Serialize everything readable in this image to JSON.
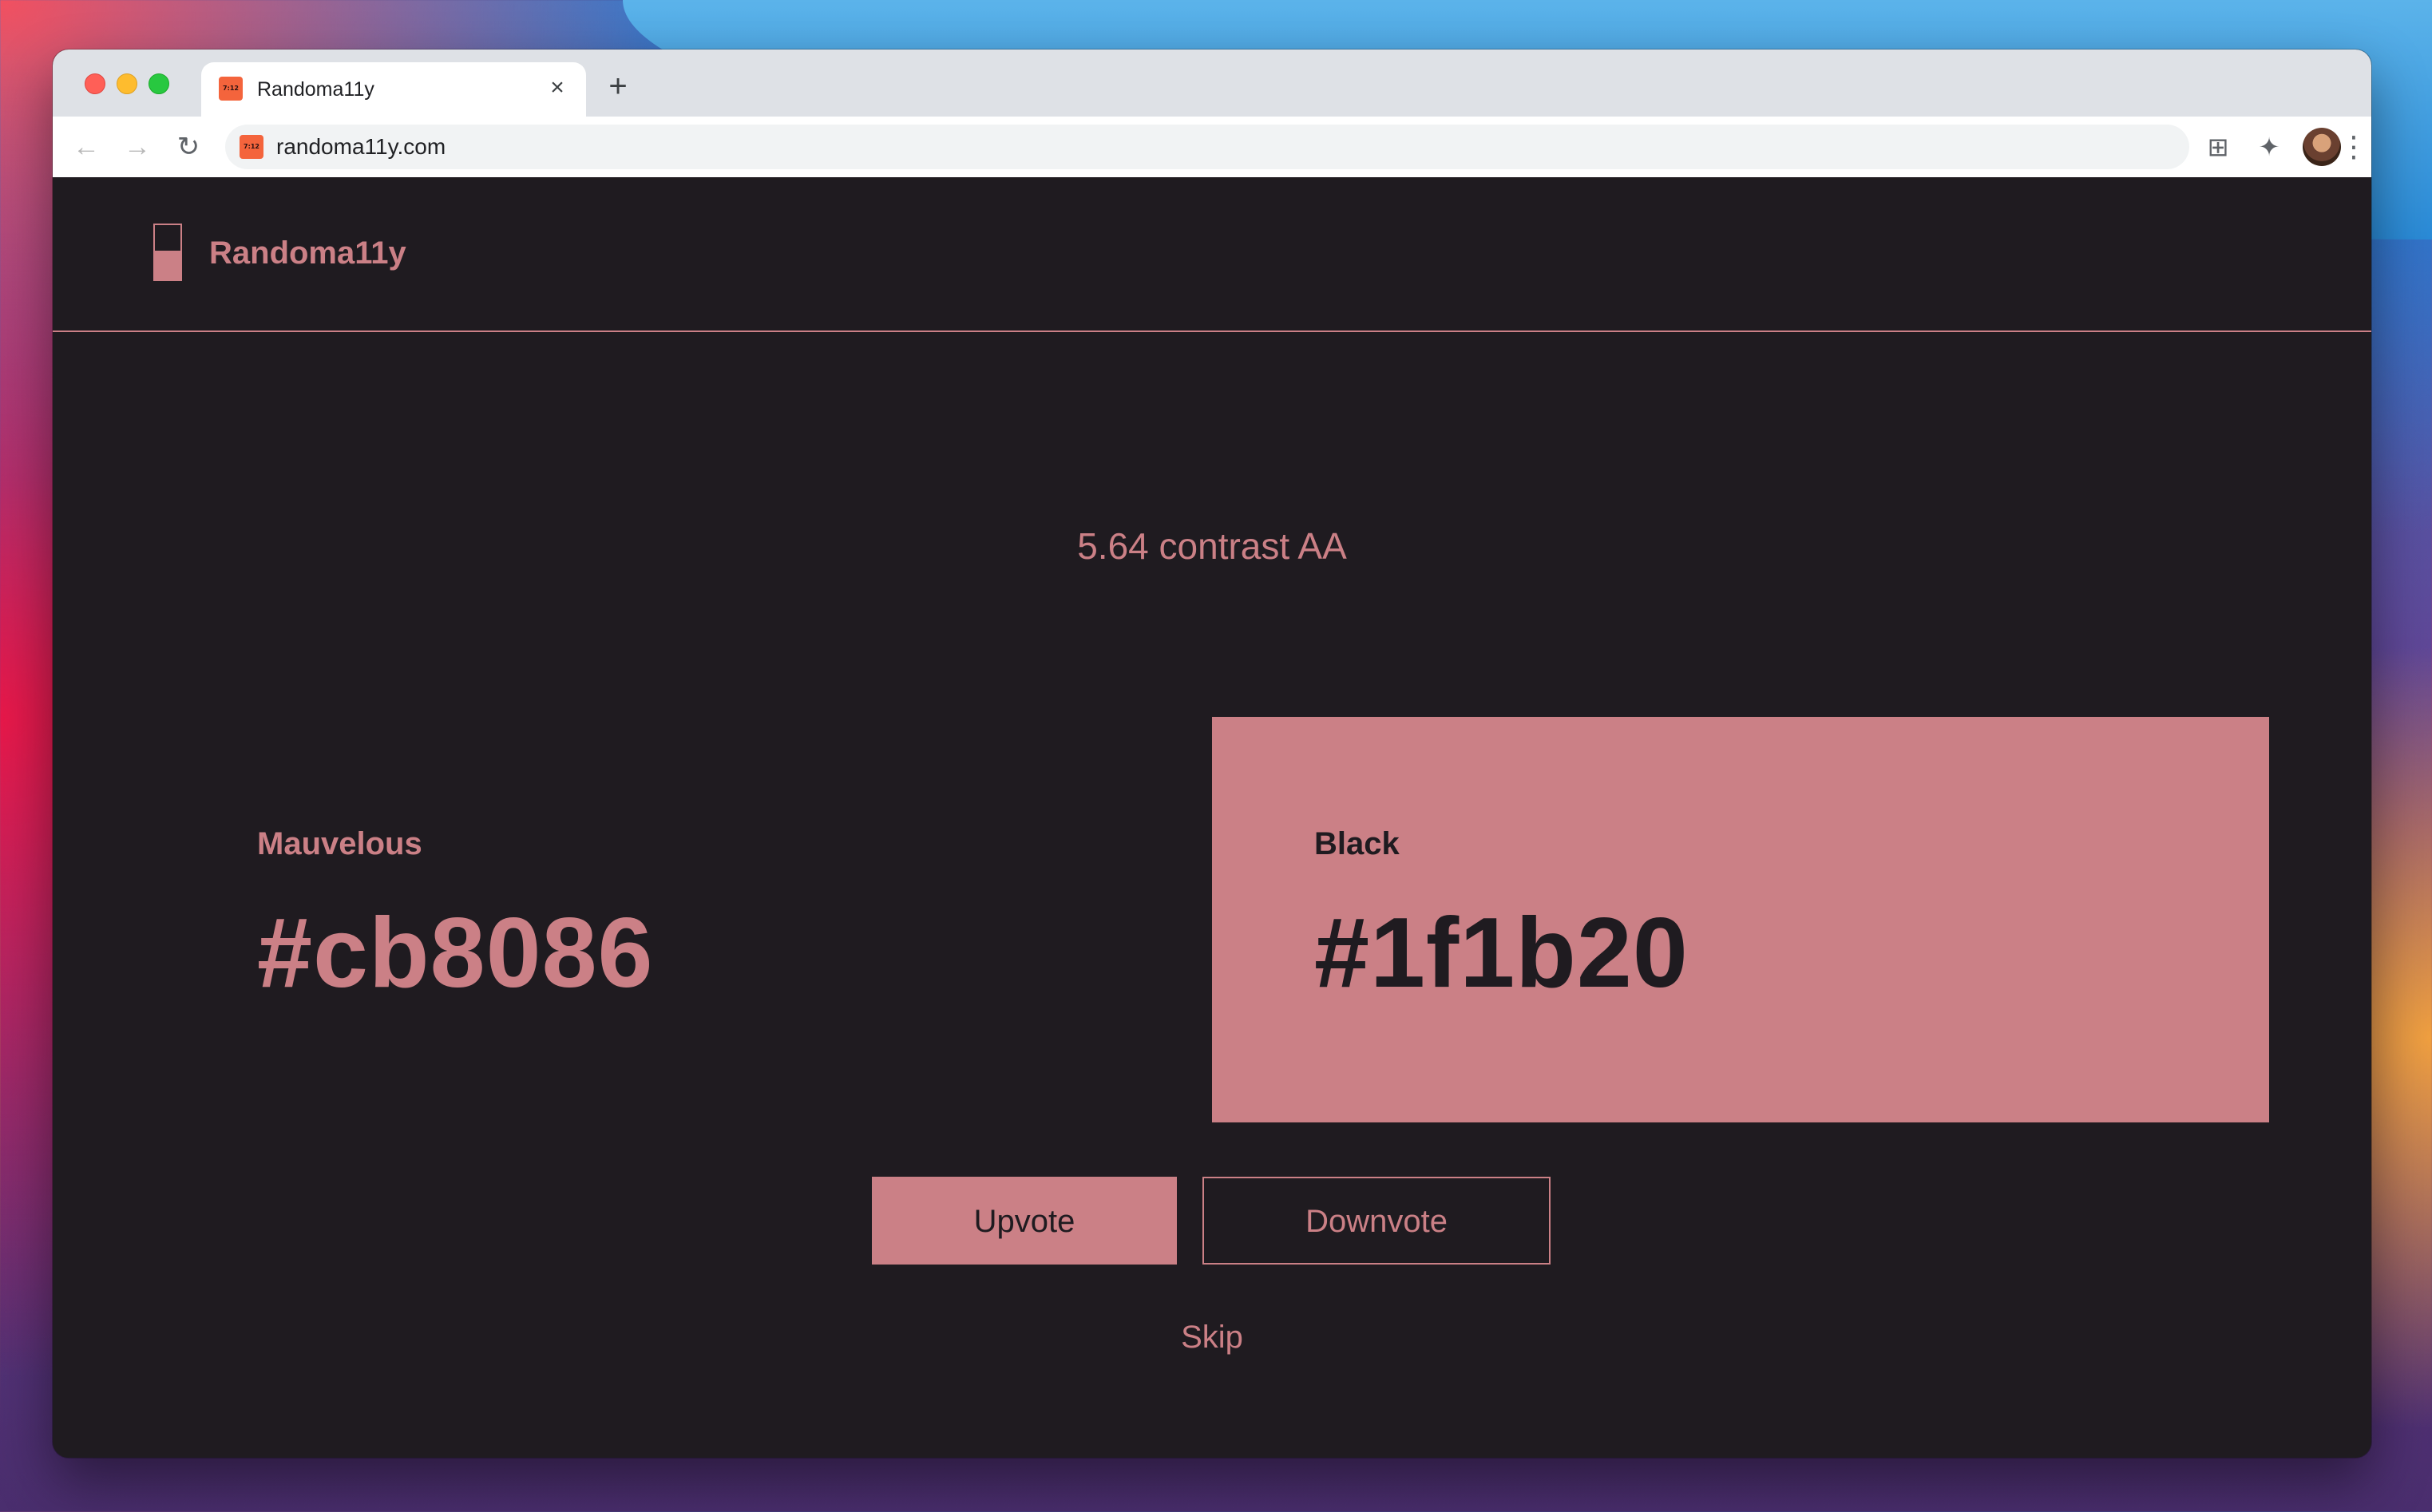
{
  "browser": {
    "tab": {
      "title": "Randoma11y",
      "favicon_text": "7:12"
    },
    "address_bar": {
      "url": "randoma11y.com"
    },
    "icons": {
      "back": "back-arrow-icon",
      "forward": "forward-arrow-icon",
      "reload": "reload-icon",
      "tab_search": "tab-grid-icon",
      "extensions": "puzzle-piece-icon",
      "menu": "kebab-menu-icon"
    },
    "glyphs": {
      "close": "×",
      "new_tab": "+",
      "back": "←",
      "forward": "→",
      "reload": "↻",
      "tab_search": "⊞",
      "extensions": "✦",
      "menu": "⋮"
    }
  },
  "site": {
    "name": "Randoma11y",
    "contrast_text": "5.64 contrast AA",
    "colors": {
      "mauvelous": "#cb8086",
      "black": "#1f1b20"
    },
    "pair": {
      "left": {
        "name": "Mauvelous",
        "hex": "#cb8086"
      },
      "right": {
        "name": "Black",
        "hex": "#1f1b20"
      }
    },
    "actions": {
      "upvote": "Upvote",
      "downvote": "Downvote",
      "skip": "Skip"
    }
  }
}
